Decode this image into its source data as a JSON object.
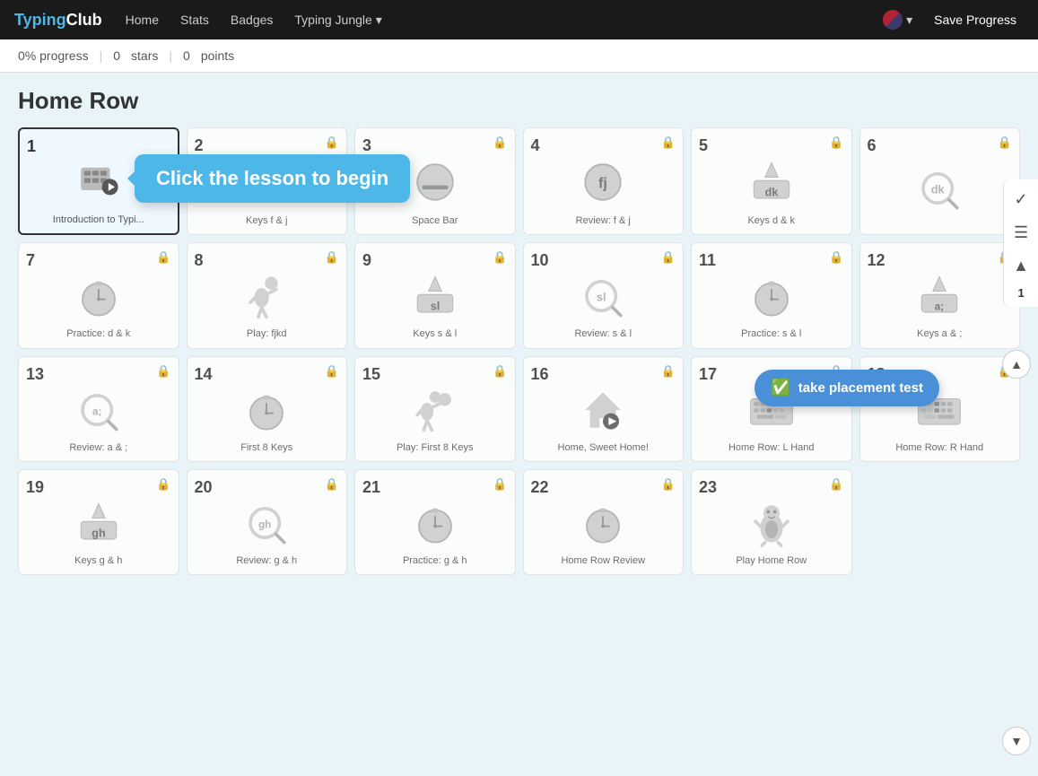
{
  "brand": {
    "name": "TypingClub"
  },
  "nav": {
    "links": [
      {
        "label": "Home",
        "id": "home"
      },
      {
        "label": "Stats",
        "id": "stats"
      },
      {
        "label": "Badges",
        "id": "badges"
      },
      {
        "label": "Typing Jungle",
        "id": "typing-jungle",
        "arrow": true
      }
    ],
    "save_label": "Save Progress",
    "flag_label": "US",
    "flag_arrow": "▾"
  },
  "progress": {
    "percent": "0%",
    "progress_label": "progress",
    "stars": "0",
    "stars_label": "stars",
    "points": "0",
    "points_label": "points"
  },
  "section": {
    "title": "Home Row"
  },
  "tooltip": "Click the lesson to begin",
  "placement_btn": "take placement test",
  "lessons": [
    {
      "number": "1",
      "label": "Introduction to Typi...",
      "locked": false,
      "active": true,
      "icon": "typing"
    },
    {
      "number": "2",
      "label": "Keys f & j",
      "locked": true,
      "icon": "keys-fj"
    },
    {
      "number": "3",
      "label": "Space Bar",
      "locked": true,
      "icon": "spacebar"
    },
    {
      "number": "4",
      "label": "Review: f & j",
      "locked": true,
      "icon": "review-fj"
    },
    {
      "number": "5",
      "label": "Keys d & k",
      "locked": true,
      "icon": "keys-dk"
    },
    {
      "number": "6",
      "label": "",
      "locked": true,
      "icon": "review-dk"
    },
    {
      "number": "7",
      "label": "Practice: d & k",
      "locked": true,
      "icon": "stopwatch"
    },
    {
      "number": "8",
      "label": "Play: fjkd",
      "locked": true,
      "icon": "play-fjkd"
    },
    {
      "number": "9",
      "label": "Keys s & l",
      "locked": true,
      "icon": "keys-sl"
    },
    {
      "number": "10",
      "label": "Review: s & l",
      "locked": true,
      "icon": "review-sl"
    },
    {
      "number": "11",
      "label": "Practice: s & l",
      "locked": true,
      "icon": "stopwatch"
    },
    {
      "number": "12",
      "label": "Keys a & ;",
      "locked": true,
      "icon": "keys-a"
    },
    {
      "number": "13",
      "label": "Review: a & ;",
      "locked": true,
      "icon": "review-a"
    },
    {
      "number": "14",
      "label": "First 8 Keys",
      "locked": true,
      "icon": "stopwatch"
    },
    {
      "number": "15",
      "label": "Play: First 8 Keys",
      "locked": true,
      "icon": "play-8"
    },
    {
      "number": "16",
      "label": "Home, Sweet Home!",
      "locked": true,
      "icon": "home"
    },
    {
      "number": "17",
      "label": "Home Row: L Hand",
      "locked": true,
      "icon": "keyboard-l"
    },
    {
      "number": "18",
      "label": "Home Row: R Hand",
      "locked": true,
      "icon": "keyboard-r"
    },
    {
      "number": "19",
      "label": "Keys g & h",
      "locked": true,
      "icon": "keys-gh"
    },
    {
      "number": "20",
      "label": "Review: g & h",
      "locked": true,
      "icon": "review-gh"
    },
    {
      "number": "21",
      "label": "Practice: g & h",
      "locked": true,
      "icon": "stopwatch"
    },
    {
      "number": "22",
      "label": "Home Row Review",
      "locked": true,
      "icon": "stopwatch"
    },
    {
      "number": "23",
      "label": "Play Home Row",
      "locked": true,
      "icon": "play-home"
    }
  ]
}
